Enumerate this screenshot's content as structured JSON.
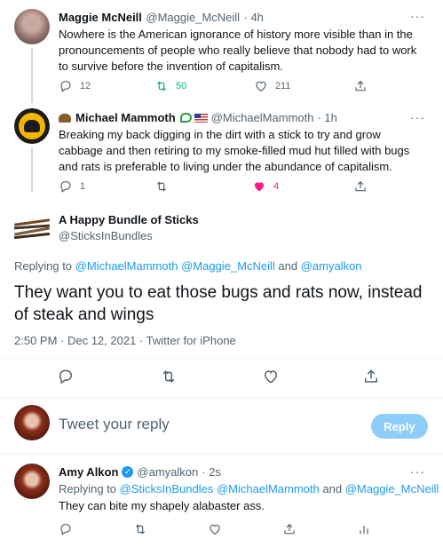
{
  "tweets": [
    {
      "name": "Maggie McNeill",
      "handle": "@Maggie_McNeill",
      "time": "· 4h",
      "text": "Nowhere is the American ignorance of history more visible than in the pronouncements of people who really believe that nobody had to work to survive before the invention of capitalism.",
      "replies": "12",
      "retweets": "50",
      "likes": "211"
    },
    {
      "name": "Michael Mammoth",
      "handle": "@MichaelMammoth",
      "time": "· 1h",
      "text": "Breaking my back digging in the dirt with a stick to try and grow cabbage and then retiring to my smoke-filled mud hut filled with bugs and rats is preferable to living under the abundance of capitalism.",
      "replies": "1",
      "retweets": "",
      "likes": "4"
    }
  ],
  "main_tweet": {
    "name": "A Happy Bundle of Sticks",
    "handle": "@SticksInBundles",
    "replying_prefix": "Replying to",
    "replying_to": "@MichaelMammoth @Maggie_McNeill",
    "replying_and": "and",
    "replying_last": "@amyalkon",
    "text": "They want you to eat those bugs and rats now, instead of steak and wings",
    "timestamp": "2:50 PM · Dec 12, 2021 · Twitter for iPhone"
  },
  "compose": {
    "placeholder": "Tweet your reply",
    "button": "Reply",
    "accent": "#1d9bf0"
  },
  "reply": {
    "name": "Amy Alkon",
    "handle": "@amyalkon",
    "time": "· 2s",
    "replying_prefix": "Replying to",
    "replying_to": "@SticksInBundles @MichaelMammoth",
    "replying_and": "and",
    "replying_last": "@Maggie_McNeill",
    "text": "They can bite my shapely alabaster ass."
  },
  "icons": {
    "reply": "reply-icon",
    "retweet": "retweet-icon",
    "like": "heart-icon",
    "share": "share-icon",
    "analytics": "analytics-icon",
    "more": "more-icon",
    "verified": "verified-badge-icon"
  },
  "colors": {
    "retweet_active": "#00ba7c",
    "like_active": "#f91880",
    "link": "#1d9bf0"
  },
  "more_glyph": "···"
}
